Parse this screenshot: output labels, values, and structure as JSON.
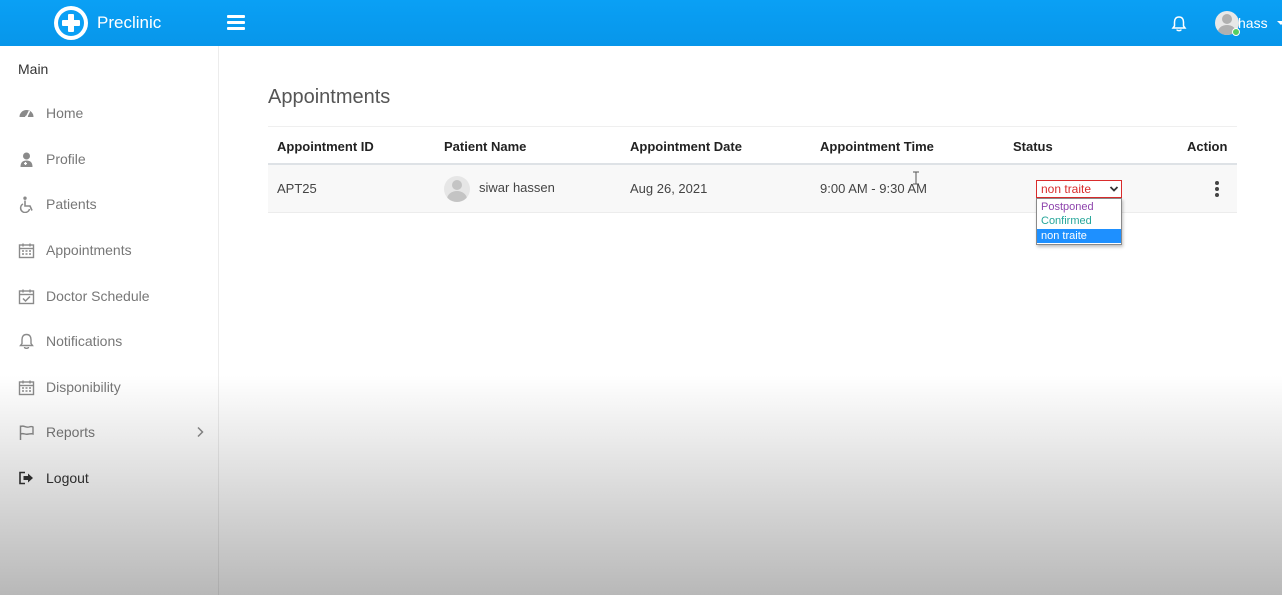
{
  "topbar": {
    "brand": "Preclinic",
    "user_name": "hass",
    "bg_color": "#0aa0f5"
  },
  "sidebar": {
    "title": "Main",
    "items": [
      {
        "label": "Home",
        "icon": "dashboard-icon"
      },
      {
        "label": "Profile",
        "icon": "user-md-icon"
      },
      {
        "label": "Patients",
        "icon": "wheelchair-icon"
      },
      {
        "label": "Appointments",
        "icon": "calendar-icon"
      },
      {
        "label": "Doctor Schedule",
        "icon": "calendar-check-icon"
      },
      {
        "label": "Notifications",
        "icon": "bell-icon"
      },
      {
        "label": "Disponibility",
        "icon": "calendar-icon"
      },
      {
        "label": "Reports",
        "icon": "flag-icon"
      },
      {
        "label": "Logout",
        "icon": "sign-out-icon"
      }
    ]
  },
  "main": {
    "title": "Appointments",
    "table": {
      "headers": [
        "Appointment ID",
        "Patient Name",
        "Appointment Date",
        "Appointment Time",
        "Status",
        "Action"
      ],
      "rows": [
        {
          "id": "APT25",
          "patient": "siwar hassen",
          "date": "Aug 26, 2021",
          "time": "9:00 AM - 9:30 AM",
          "status": "non traite"
        }
      ]
    },
    "status_options": [
      {
        "label": "Postponed",
        "color": "#8e44ad"
      },
      {
        "label": "Confirmed",
        "color": "#26a69a"
      },
      {
        "label": "non traite",
        "color": "#ffffff",
        "selected": true
      }
    ],
    "status_color": "#d92c2c",
    "highlight_color": "#1e90ff"
  }
}
